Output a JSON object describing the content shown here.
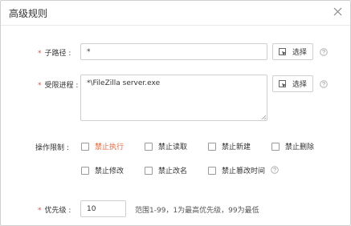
{
  "dialog": {
    "title": "高级规则",
    "close_icon": "close-icon"
  },
  "subpath": {
    "label": "子路径 :",
    "required_mark": "*",
    "value": "*",
    "button_label": "选择",
    "button_icon": "select-cursor-icon",
    "help_icon": "question-circle-icon"
  },
  "process": {
    "label": "受限进程 :",
    "required_mark": "*",
    "value": "*\\FileZilla server.exe",
    "button_label": "选择",
    "button_icon": "select-cursor-icon",
    "help_icon": "question-circle-icon"
  },
  "restrictions": {
    "label": "操作限制 :",
    "options": [
      {
        "label": "禁止执行",
        "checked": false,
        "highlighted": true
      },
      {
        "label": "禁止读取",
        "checked": false
      },
      {
        "label": "禁止新建",
        "checked": false
      },
      {
        "label": "禁止删除",
        "checked": false
      },
      {
        "label": "禁止修改",
        "checked": false
      },
      {
        "label": "禁止改名",
        "checked": false
      },
      {
        "label": "禁止篡改时间",
        "checked": false
      }
    ],
    "help_icon": "question-circle-icon",
    "highlight_color": "#e8683b"
  },
  "priority": {
    "label": "优先级 :",
    "required_mark": "*",
    "value": "10",
    "hint": "范围1-99，1为最高优先级，99为最低"
  },
  "colors": {
    "required": "#e74c3c",
    "border": "#cfcfcf"
  }
}
